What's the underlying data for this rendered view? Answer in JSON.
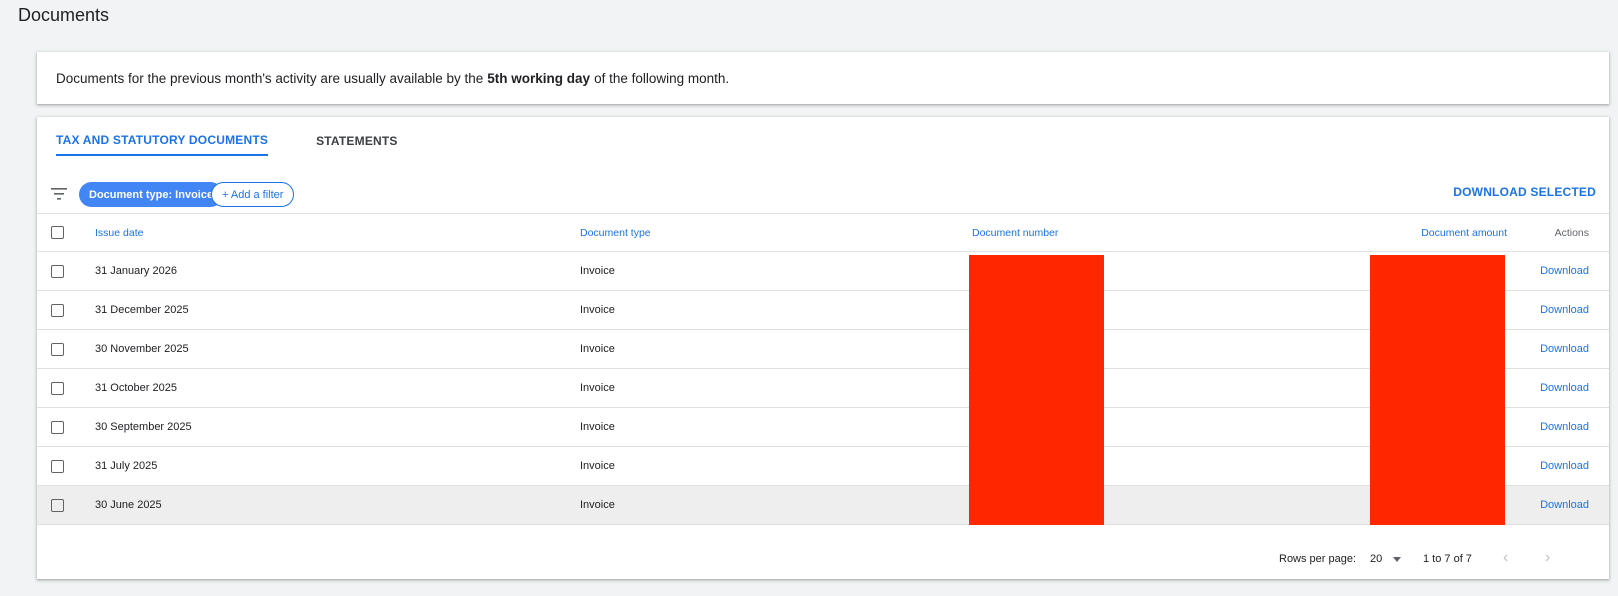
{
  "page": {
    "title": "Documents"
  },
  "notice": {
    "before": "Documents for the previous month's activity are usually available by the",
    "bold": "5th working day",
    "after": "of the following month."
  },
  "tabs": [
    {
      "label": "TAX AND STATUTORY DOCUMENTS",
      "active": true
    },
    {
      "label": "STATEMENTS",
      "active": false
    }
  ],
  "filters": {
    "active_chip": "Document type: Invoice",
    "add_filter": "+ Add a filter",
    "download_selected": "DOWNLOAD SELECTED"
  },
  "table": {
    "headers": {
      "issue_date": "Issue date",
      "document_type": "Document type",
      "document_number": "Document number",
      "document_amount": "Document amount",
      "actions": "Actions"
    },
    "rows": [
      {
        "issue_date": "31 January 2026",
        "document_type": "Invoice",
        "action": "Download"
      },
      {
        "issue_date": "31 December 2025",
        "document_type": "Invoice",
        "action": "Download"
      },
      {
        "issue_date": "30 November 2025",
        "document_type": "Invoice",
        "action": "Download"
      },
      {
        "issue_date": "31 October 2025",
        "document_type": "Invoice",
        "action": "Download"
      },
      {
        "issue_date": "30 September 2025",
        "document_type": "Invoice",
        "action": "Download"
      },
      {
        "issue_date": "31 July 2025",
        "document_type": "Invoice",
        "action": "Download"
      },
      {
        "issue_date": "30 June 2025",
        "document_type": "Invoice",
        "action": "Download"
      }
    ]
  },
  "pagination": {
    "rows_per_page_label": "Rows per page:",
    "rows_per_page": "20",
    "range": "1 to 7 of 7"
  },
  "colors": {
    "accent": "#1a73e8",
    "chip": "#4285f4",
    "redaction": "#ff2600",
    "background": "#f1f3f4"
  }
}
